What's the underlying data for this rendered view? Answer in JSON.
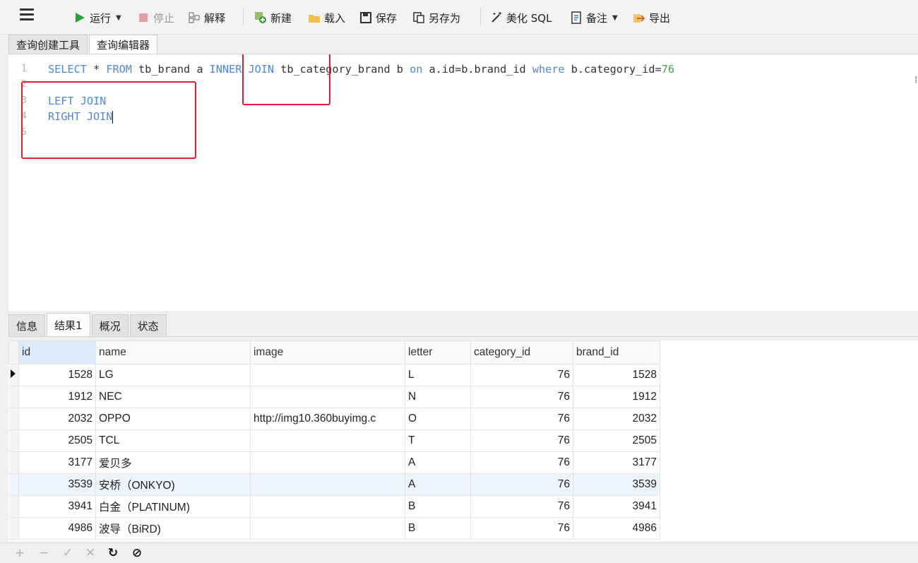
{
  "toolbar": {
    "run": "运行",
    "stop": "停止",
    "explain": "解释",
    "new": "新建",
    "load": "载入",
    "save": "保存",
    "save_as": "另存为",
    "beautify": "美化 SQL",
    "comment": "备注",
    "export": "导出"
  },
  "editor_tabs": [
    "查询创建工具",
    "查询编辑器"
  ],
  "sql_lines": [
    {
      "n": "1",
      "tokens": [
        {
          "t": "SELECT",
          "k": "kw"
        },
        {
          "t": " * ",
          "k": ""
        },
        {
          "t": "FROM",
          "k": "kw"
        },
        {
          "t": " tb_brand a ",
          "k": ""
        },
        {
          "t": "INNER JOIN",
          "k": "kw"
        },
        {
          "t": " tb_category_brand b ",
          "k": ""
        },
        {
          "t": "on",
          "k": "kw"
        },
        {
          "t": " a.id=b.brand_id ",
          "k": ""
        },
        {
          "t": "where",
          "k": "kw"
        },
        {
          "t": " b.category_id=",
          "k": ""
        },
        {
          "t": "76",
          "k": "num"
        }
      ]
    },
    {
      "n": "2",
      "tokens": []
    },
    {
      "n": "3",
      "tokens": [
        {
          "t": "LEFT JOIN",
          "k": "kw"
        }
      ]
    },
    {
      "n": "4",
      "tokens": [
        {
          "t": "RIGHT JOIN",
          "k": "kw"
        }
      ]
    },
    {
      "n": "5",
      "tokens": []
    }
  ],
  "result_tabs": [
    "信息",
    "结果1",
    "概况",
    "状态"
  ],
  "grid": {
    "columns": [
      "id",
      "name",
      "image",
      "letter",
      "category_id",
      "brand_id"
    ],
    "rows": [
      [
        "1528",
        "LG",
        "",
        "L",
        "76",
        "1528"
      ],
      [
        "1912",
        "NEC",
        "",
        "N",
        "76",
        "1912"
      ],
      [
        "2032",
        "OPPO",
        "http://img10.360buyimg.c",
        "O",
        "76",
        "2032"
      ],
      [
        "2505",
        "TCL",
        "",
        "T",
        "76",
        "2505"
      ],
      [
        "3177",
        "爱贝多",
        "",
        "A",
        "76",
        "3177"
      ],
      [
        "3539",
        "安桥（ONKYO)",
        "",
        "A",
        "76",
        "3539"
      ],
      [
        "3941",
        "白金（PLATINUM)",
        "",
        "B",
        "76",
        "3941"
      ],
      [
        "4986",
        "波导（BiRD)",
        "",
        "B",
        "76",
        "4986"
      ]
    ]
  },
  "bottom_bar": {
    "add": "+",
    "remove": "−",
    "apply": "✓",
    "discard": "✕"
  },
  "colors": {
    "keyword": "#4f86d9",
    "number": "#43a34a",
    "highlight": "#e0202e"
  }
}
